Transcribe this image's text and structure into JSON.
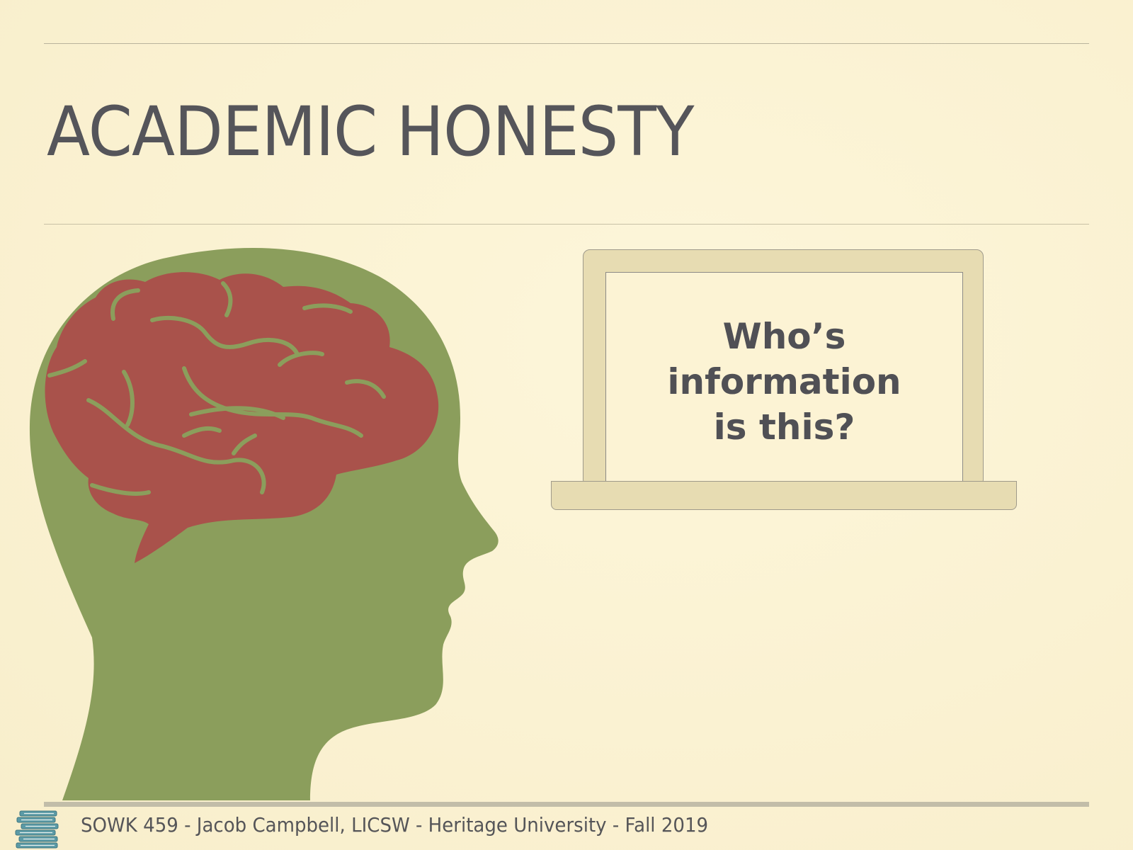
{
  "slide": {
    "title": "ACADEMIC HONESTY",
    "laptop": {
      "lines": [
        "Who’s",
        "information",
        "is this?"
      ]
    },
    "footer": "SOWK 459 - Jacob Campbell, LICSW - Heritage University - Fall 2019"
  },
  "icons": {
    "head": "head-with-brain-icon",
    "laptop": "laptop-icon",
    "books": "book-stack-icon"
  },
  "colors": {
    "background": "#fcf3d4",
    "head": "#8b9e5c",
    "brain": "#a9524b",
    "laptop": "#e7dcb2",
    "text": "#55555a"
  }
}
